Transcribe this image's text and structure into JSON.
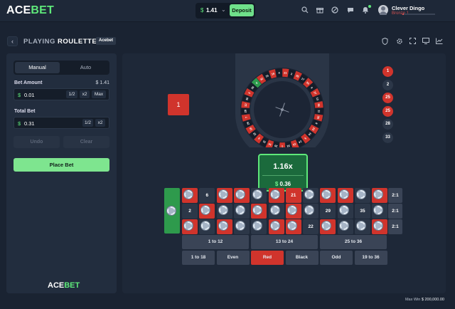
{
  "header": {
    "logo": {
      "part1": "ACE",
      "part2": "BET"
    },
    "wallet": {
      "currency_symbol": "$",
      "balance": "1.41"
    },
    "deposit_label": "Deposit",
    "user": {
      "name": "Clever Dingo",
      "rank": "Bronze 1"
    },
    "rank_progress": 0.04
  },
  "page": {
    "title_prefix": "PLAYING",
    "title_game": "ROULETTE",
    "provider_tag": "Acebet"
  },
  "bet_panel": {
    "tabs": {
      "manual": "Manual",
      "auto": "Auto"
    },
    "bet_amount_label": "Bet Amount",
    "balance_display": "$ 1.41",
    "bet_amount_value": "0.01",
    "currency_symbol": "$",
    "half_label": "1/2",
    "double_label": "x2",
    "max_label": "Max",
    "total_bet_label": "Total Bet",
    "total_bet_value": "0.31",
    "undo_label": "Undo",
    "clear_label": "Clear",
    "place_bet_label": "Place Bet",
    "footer_logo": {
      "part1": "ACE",
      "part2": "BET"
    }
  },
  "game": {
    "last_result": "1",
    "multiplier": "1.16x",
    "payout_currency": "$",
    "payout": "0.36",
    "history": [
      {
        "n": "1",
        "color": "red"
      },
      {
        "n": "2",
        "color": "black"
      },
      {
        "n": "25",
        "color": "red"
      },
      {
        "n": "25",
        "color": "red"
      },
      {
        "n": "28",
        "color": "black"
      },
      {
        "n": "33",
        "color": "black"
      }
    ],
    "wheel_numbers": [
      "0",
      "32",
      "15",
      "19",
      "4",
      "21",
      "2",
      "25",
      "17",
      "34",
      "6",
      "27",
      "13",
      "36",
      "11",
      "30",
      "8",
      "23",
      "10",
      "5",
      "24",
      "16",
      "33",
      "1",
      "20",
      "14",
      "31",
      "9",
      "22",
      "18",
      "29",
      "7",
      "28",
      "12",
      "35",
      "3",
      "26"
    ],
    "max_win": "$ 200,000.00",
    "max_win_label": "Max Win"
  },
  "table": {
    "rows": [
      [
        {
          "label": "",
          "color": "red",
          "chip": true
        },
        {
          "label": "6",
          "color": "black",
          "chip": false
        },
        {
          "label": "",
          "color": "red",
          "chip": true
        },
        {
          "label": "",
          "color": "red",
          "chip": true
        },
        {
          "label": "",
          "color": "black",
          "chip": true
        },
        {
          "label": "",
          "color": "red",
          "chip": true
        },
        {
          "label": "21",
          "color": "red",
          "chip": false
        },
        {
          "label": "",
          "color": "black",
          "chip": true
        },
        {
          "label": "",
          "color": "red",
          "chip": true
        },
        {
          "label": "",
          "color": "red",
          "chip": true
        },
        {
          "label": "",
          "color": "black",
          "chip": true
        },
        {
          "label": "",
          "color": "red",
          "chip": true
        }
      ],
      [
        {
          "label": "2",
          "color": "black",
          "chip": false
        },
        {
          "label": "",
          "color": "red",
          "chip": true
        },
        {
          "label": "",
          "color": "black",
          "chip": true
        },
        {
          "label": "",
          "color": "black",
          "chip": true
        },
        {
          "label": "",
          "color": "red",
          "chip": true
        },
        {
          "label": "",
          "color": "black",
          "chip": true
        },
        {
          "label": "",
          "color": "red",
          "chip": true
        },
        {
          "label": "",
          "color": "black",
          "chip": true
        },
        {
          "label": "29",
          "color": "black",
          "chip": false
        },
        {
          "label": "",
          "color": "black",
          "chip": true
        },
        {
          "label": "35",
          "color": "black",
          "chip": false
        },
        {
          "label": "",
          "color": "black",
          "chip": true
        }
      ],
      [
        {
          "label": "",
          "color": "red",
          "chip": true
        },
        {
          "label": "",
          "color": "black",
          "chip": true
        },
        {
          "label": "",
          "color": "red",
          "chip": true
        },
        {
          "label": "",
          "color": "black",
          "chip": true
        },
        {
          "label": "",
          "color": "black",
          "chip": true
        },
        {
          "label": "",
          "color": "red",
          "chip": true
        },
        {
          "label": "",
          "color": "red",
          "chip": true
        },
        {
          "label": "22",
          "color": "black",
          "chip": false
        },
        {
          "label": "",
          "color": "red",
          "chip": true
        },
        {
          "label": "",
          "color": "black",
          "chip": true
        },
        {
          "label": "",
          "color": "black",
          "chip": true
        },
        {
          "label": "",
          "color": "red",
          "chip": true
        }
      ]
    ],
    "column_bets": [
      "2:1",
      "2:1",
      "2:1"
    ],
    "dozens": [
      "1 to 12",
      "13 to 24",
      "25 to 36"
    ],
    "outside_bets": [
      "1 to 18",
      "Even",
      "Red",
      "Black",
      "Odd",
      "19 to 36"
    ]
  }
}
